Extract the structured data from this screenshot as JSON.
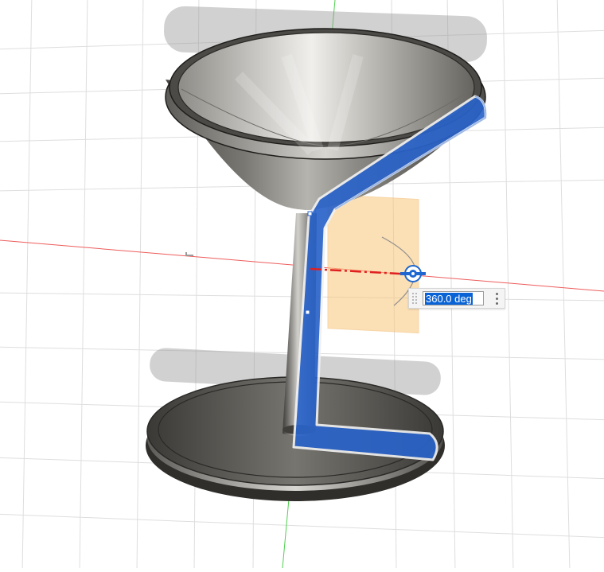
{
  "viewport": {
    "background": "#ffffff",
    "grid_color": "#dcdcdc",
    "x_axis_color": "#e53935",
    "y_axis_color": "#43c443",
    "model": {
      "kind": "martini glass",
      "body_color": "#5c5a56",
      "selection_color": "#2a63c9",
      "sketch_plane_color": "#f9c97a"
    }
  },
  "revolve_manipulator": {
    "angle_value": "360.0 deg",
    "handle_icon": "rotate-handle-icon",
    "menu_icon": "more-vertical-icon"
  }
}
